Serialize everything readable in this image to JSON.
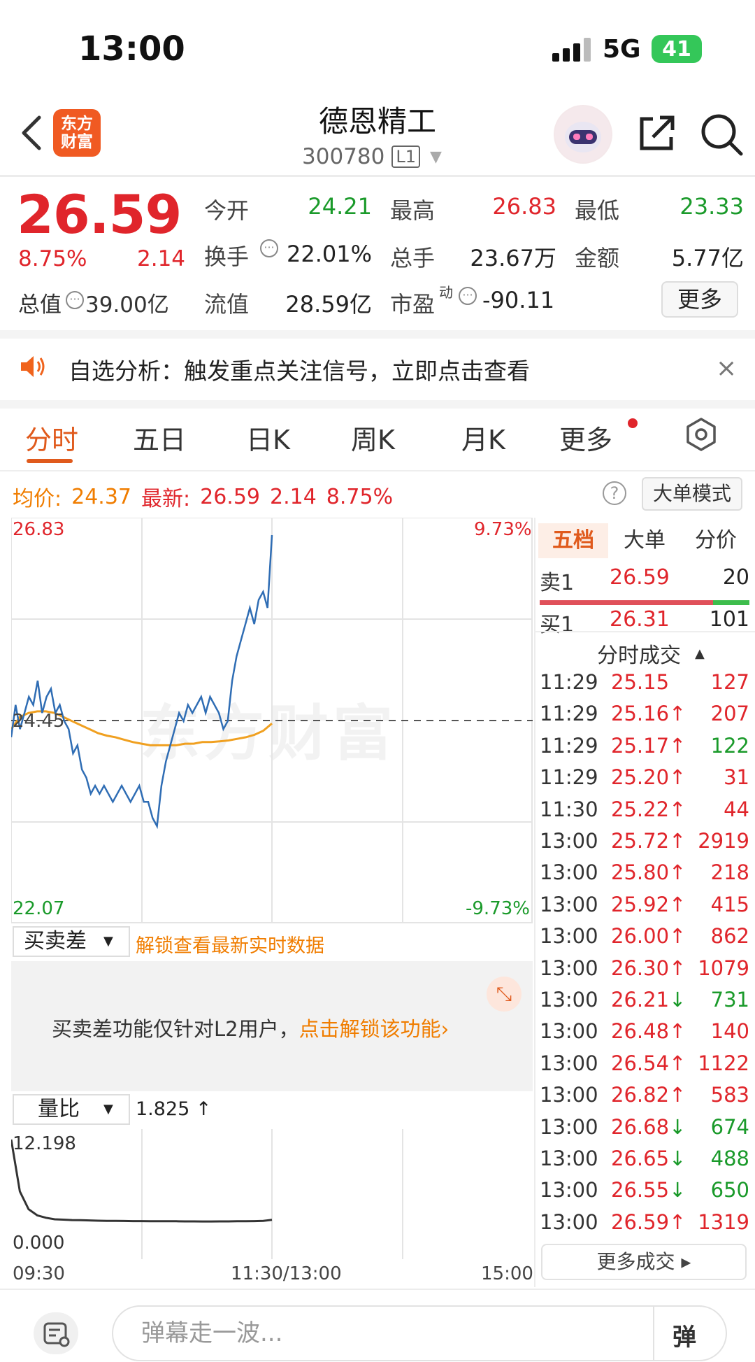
{
  "status": {
    "time": "13:00",
    "network": "5G",
    "battery": "41"
  },
  "header": {
    "logo_line1": "东方",
    "logo_line2": "财富",
    "name": "德恩精工",
    "code": "300780",
    "level": "L1"
  },
  "quote": {
    "price": "26.59",
    "pct_change": "8.75%",
    "abs_change": "2.14",
    "total_value_label": "总值",
    "total_value": "39.00亿",
    "fields": {
      "open_label": "今开",
      "open": "24.21",
      "high_label": "最高",
      "high": "26.83",
      "low_label": "最低",
      "low": "23.33",
      "turnover_label": "换手",
      "turnover": "22.01%",
      "volume_label": "总手",
      "volume": "23.67万",
      "amount_label": "金额",
      "amount": "5.77亿",
      "float_label": "流值",
      "float": "28.59亿",
      "pe_label": "市盈",
      "pe_sup": "动",
      "pe": "-90.11"
    },
    "more_label": "更多"
  },
  "notice": {
    "text": "自选分析：触发重点关注信号，立即点击查看",
    "close": "×"
  },
  "tabs": [
    "分时",
    "五日",
    "日K",
    "周K",
    "月K",
    "更多"
  ],
  "info": {
    "avg_label": "均价:",
    "avg": "24.37",
    "latest_label": "最新:",
    "latest": "26.59",
    "change": "2.14",
    "pct": "8.75%",
    "help": "?",
    "bigorder_btn": "大单模式"
  },
  "chart": {
    "price_high": "26.83",
    "price_low": "22.07",
    "pct_high": "9.73%",
    "pct_low": "-9.73%",
    "mid_label": "24.45",
    "watermark": "东方财富",
    "time_start": "09:30",
    "time_mid": "11:30/13:00",
    "time_end": "15:00"
  },
  "chart_data": {
    "type": "line",
    "ylim": [
      22.07,
      26.83
    ],
    "prev_close": 24.45,
    "series": [
      {
        "name": "price",
        "color": "#2f6db4",
        "values": [
          24.2,
          24.6,
          24.3,
          24.5,
          24.7,
          24.6,
          24.9,
          24.5,
          24.7,
          24.8,
          24.5,
          24.6,
          24.4,
          24.3,
          24.0,
          24.1,
          23.8,
          23.7,
          23.5,
          23.6,
          23.5,
          23.6,
          23.5,
          23.4,
          23.5,
          23.6,
          23.5,
          23.4,
          23.5,
          23.6,
          23.4,
          23.4,
          23.2,
          23.1,
          23.6,
          23.9,
          24.1,
          24.3,
          24.5,
          24.4,
          24.6,
          24.5,
          24.6,
          24.7,
          24.5,
          24.7,
          24.6,
          24.5,
          24.3,
          24.4,
          24.9,
          25.2,
          25.4,
          25.6,
          25.8,
          25.6,
          25.9,
          26.0,
          25.8,
          26.7
        ]
      },
      {
        "name": "average",
        "color": "#f0a020",
        "values": [
          24.3,
          24.45,
          24.5,
          24.52,
          24.52,
          24.5,
          24.45,
          24.4,
          24.35,
          24.3,
          24.25,
          24.22,
          24.2,
          24.17,
          24.14,
          24.12,
          24.1,
          24.1,
          24.1,
          24.1,
          24.12,
          24.12,
          24.14,
          24.14,
          24.15,
          24.16,
          24.18,
          24.2,
          24.23,
          24.28,
          24.37
        ]
      }
    ]
  },
  "spread": {
    "select_label": "买卖差",
    "unlock_text": "解锁查看最新实时数据",
    "msg_prefix": "买卖差功能仅针对L2用户，",
    "msg_link": "点击解锁该功能",
    "expand_icon": "⤡"
  },
  "volume_ratio": {
    "select_label": "量比",
    "value": "1.825 ↑",
    "max": "12.198",
    "min": "0.000",
    "values": [
      12.198,
      5.5,
      3.2,
      2.4,
      2.1,
      1.9,
      1.85,
      1.8,
      1.78,
      1.75,
      1.72,
      1.7,
      1.7,
      1.68,
      1.66,
      1.66,
      1.65,
      1.64,
      1.64,
      1.64,
      1.63,
      1.63,
      1.62,
      1.62,
      1.63,
      1.63,
      1.64,
      1.64,
      1.66,
      1.7,
      1.825
    ]
  },
  "orderbook": {
    "tabs": [
      "五档",
      "大单",
      "分价"
    ],
    "sell1": {
      "label": "卖1",
      "price": "26.59",
      "qty": "20"
    },
    "buy1": {
      "label": "买1",
      "price": "26.31",
      "qty": "101"
    },
    "trades_title": "分时成交",
    "trades": [
      {
        "time": "11:29",
        "price": "25.15",
        "arrow": "",
        "qty": "127",
        "dir": "up"
      },
      {
        "time": "11:29",
        "price": "25.16",
        "arrow": "↑",
        "qty": "207",
        "dir": "up"
      },
      {
        "time": "11:29",
        "price": "25.17",
        "arrow": "↑",
        "qty": "122",
        "dir": "down"
      },
      {
        "time": "11:29",
        "price": "25.20",
        "arrow": "↑",
        "qty": "31",
        "dir": "up"
      },
      {
        "time": "11:30",
        "price": "25.22",
        "arrow": "↑",
        "qty": "44",
        "dir": "up"
      },
      {
        "time": "13:00",
        "price": "25.72",
        "arrow": "↑",
        "qty": "2919",
        "dir": "up"
      },
      {
        "time": "13:00",
        "price": "25.80",
        "arrow": "↑",
        "qty": "218",
        "dir": "up"
      },
      {
        "time": "13:00",
        "price": "25.92",
        "arrow": "↑",
        "qty": "415",
        "dir": "up"
      },
      {
        "time": "13:00",
        "price": "26.00",
        "arrow": "↑",
        "qty": "862",
        "dir": "up"
      },
      {
        "time": "13:00",
        "price": "26.30",
        "arrow": "↑",
        "qty": "1079",
        "dir": "up"
      },
      {
        "time": "13:00",
        "price": "26.21",
        "arrow": "↓",
        "qty": "731",
        "dir": "down"
      },
      {
        "time": "13:00",
        "price": "26.48",
        "arrow": "↑",
        "qty": "140",
        "dir": "up"
      },
      {
        "time": "13:00",
        "price": "26.54",
        "arrow": "↑",
        "qty": "1122",
        "dir": "up"
      },
      {
        "time": "13:00",
        "price": "26.82",
        "arrow": "↑",
        "qty": "583",
        "dir": "up"
      },
      {
        "time": "13:00",
        "price": "26.68",
        "arrow": "↓",
        "qty": "674",
        "dir": "down"
      },
      {
        "time": "13:00",
        "price": "26.65",
        "arrow": "↓",
        "qty": "488",
        "dir": "down"
      },
      {
        "time": "13:00",
        "price": "26.55",
        "arrow": "↓",
        "qty": "650",
        "dir": "down"
      },
      {
        "time": "13:00",
        "price": "26.59",
        "arrow": "↑",
        "qty": "1319",
        "dir": "up"
      }
    ],
    "more_trades": "更多成交 ▸"
  },
  "bottom": {
    "placeholder": "弹幕走一波...",
    "toggle": "弹"
  }
}
